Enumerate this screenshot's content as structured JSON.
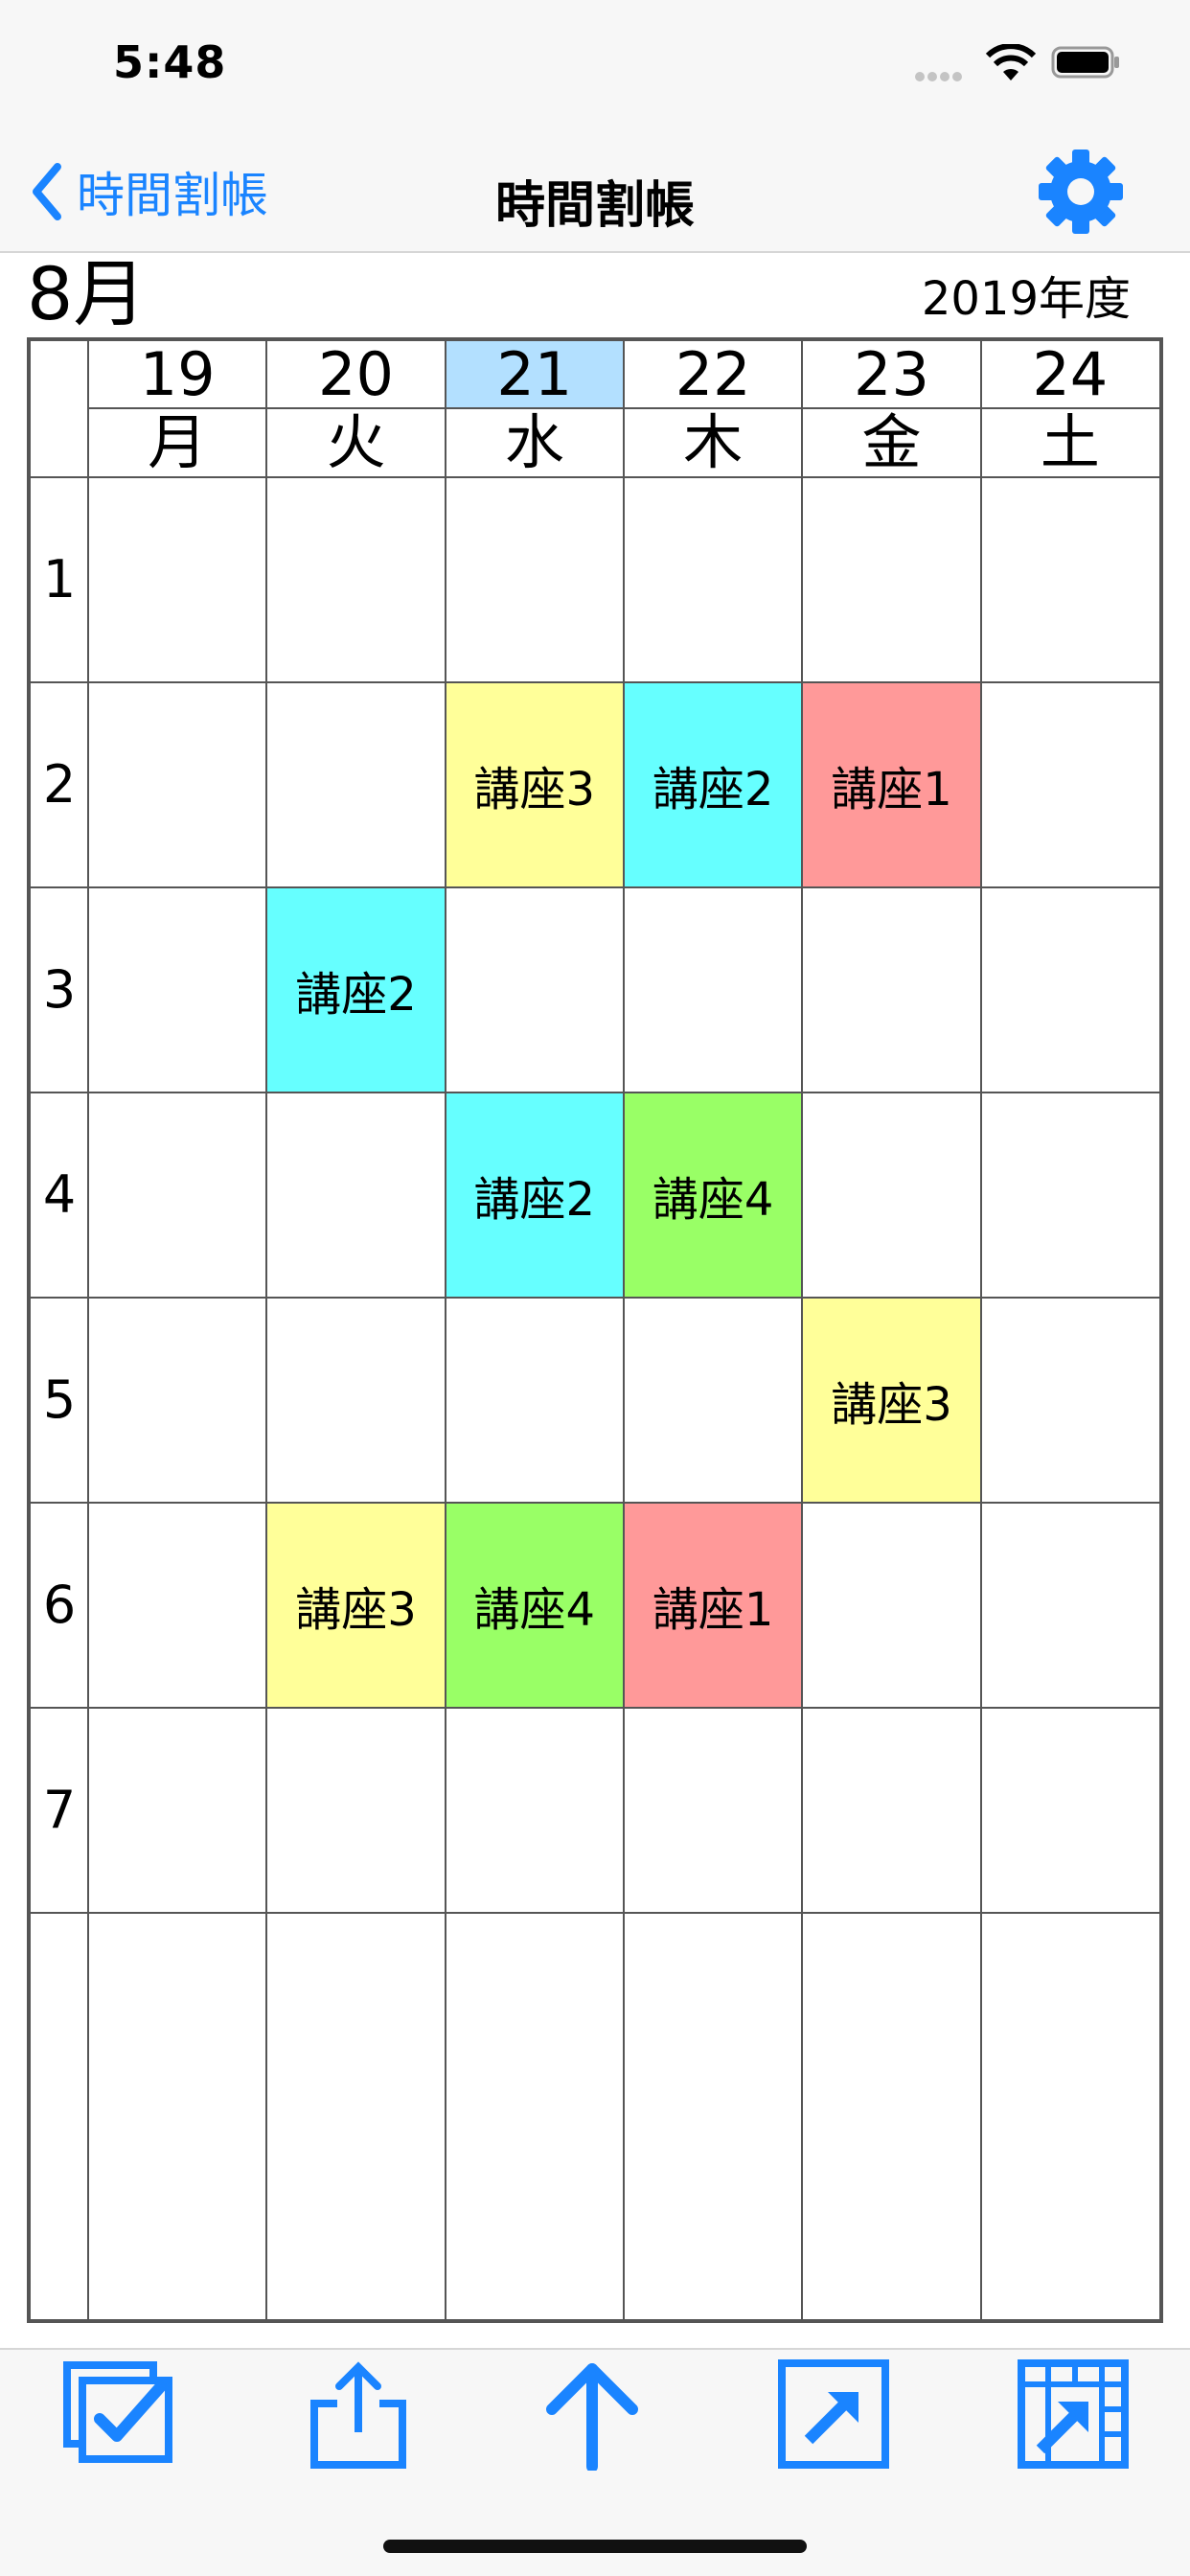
{
  "status_bar": {
    "time": "5:48"
  },
  "nav": {
    "back_label": "時間割帳",
    "title": "時間割帳",
    "settings_icon": "gear-icon"
  },
  "header": {
    "month": "8月",
    "fiscal_year": "2019年度"
  },
  "colors": {
    "accent": "#1a84ff",
    "today_highlight": "#b3e0ff",
    "yellow": "#ffff99",
    "cyan": "#66ffff",
    "red": "#ff9999",
    "green": "#99ff66"
  },
  "days": [
    {
      "date": "19",
      "dow": "月",
      "today": false
    },
    {
      "date": "20",
      "dow": "火",
      "today": false
    },
    {
      "date": "21",
      "dow": "水",
      "today": true
    },
    {
      "date": "22",
      "dow": "木",
      "today": false
    },
    {
      "date": "23",
      "dow": "金",
      "today": false
    },
    {
      "date": "24",
      "dow": "土",
      "today": false
    }
  ],
  "periods": [
    "1",
    "2",
    "3",
    "4",
    "5",
    "6",
    "7"
  ],
  "lessons": [
    {
      "day": 2,
      "period": 2,
      "label": "講座3",
      "color": "#ffff99"
    },
    {
      "day": 3,
      "period": 2,
      "label": "講座2",
      "color": "#66ffff"
    },
    {
      "day": 4,
      "period": 2,
      "label": "講座1",
      "color": "#ff9999"
    },
    {
      "day": 1,
      "period": 3,
      "label": "講座2",
      "color": "#66ffff"
    },
    {
      "day": 2,
      "period": 4,
      "label": "講座2",
      "color": "#66ffff"
    },
    {
      "day": 3,
      "period": 4,
      "label": "講座4",
      "color": "#99ff66"
    },
    {
      "day": 4,
      "period": 5,
      "label": "講座3",
      "color": "#ffff99"
    },
    {
      "day": 1,
      "period": 6,
      "label": "講座3",
      "color": "#ffff99"
    },
    {
      "day": 2,
      "period": 6,
      "label": "講座4",
      "color": "#99ff66"
    },
    {
      "day": 3,
      "period": 6,
      "label": "講座1",
      "color": "#ff9999"
    }
  ],
  "toolbar": [
    {
      "name": "select-checkbox-icon"
    },
    {
      "name": "share-icon"
    },
    {
      "name": "arrow-up-icon"
    },
    {
      "name": "open-external-icon"
    },
    {
      "name": "timetable-export-icon"
    }
  ]
}
